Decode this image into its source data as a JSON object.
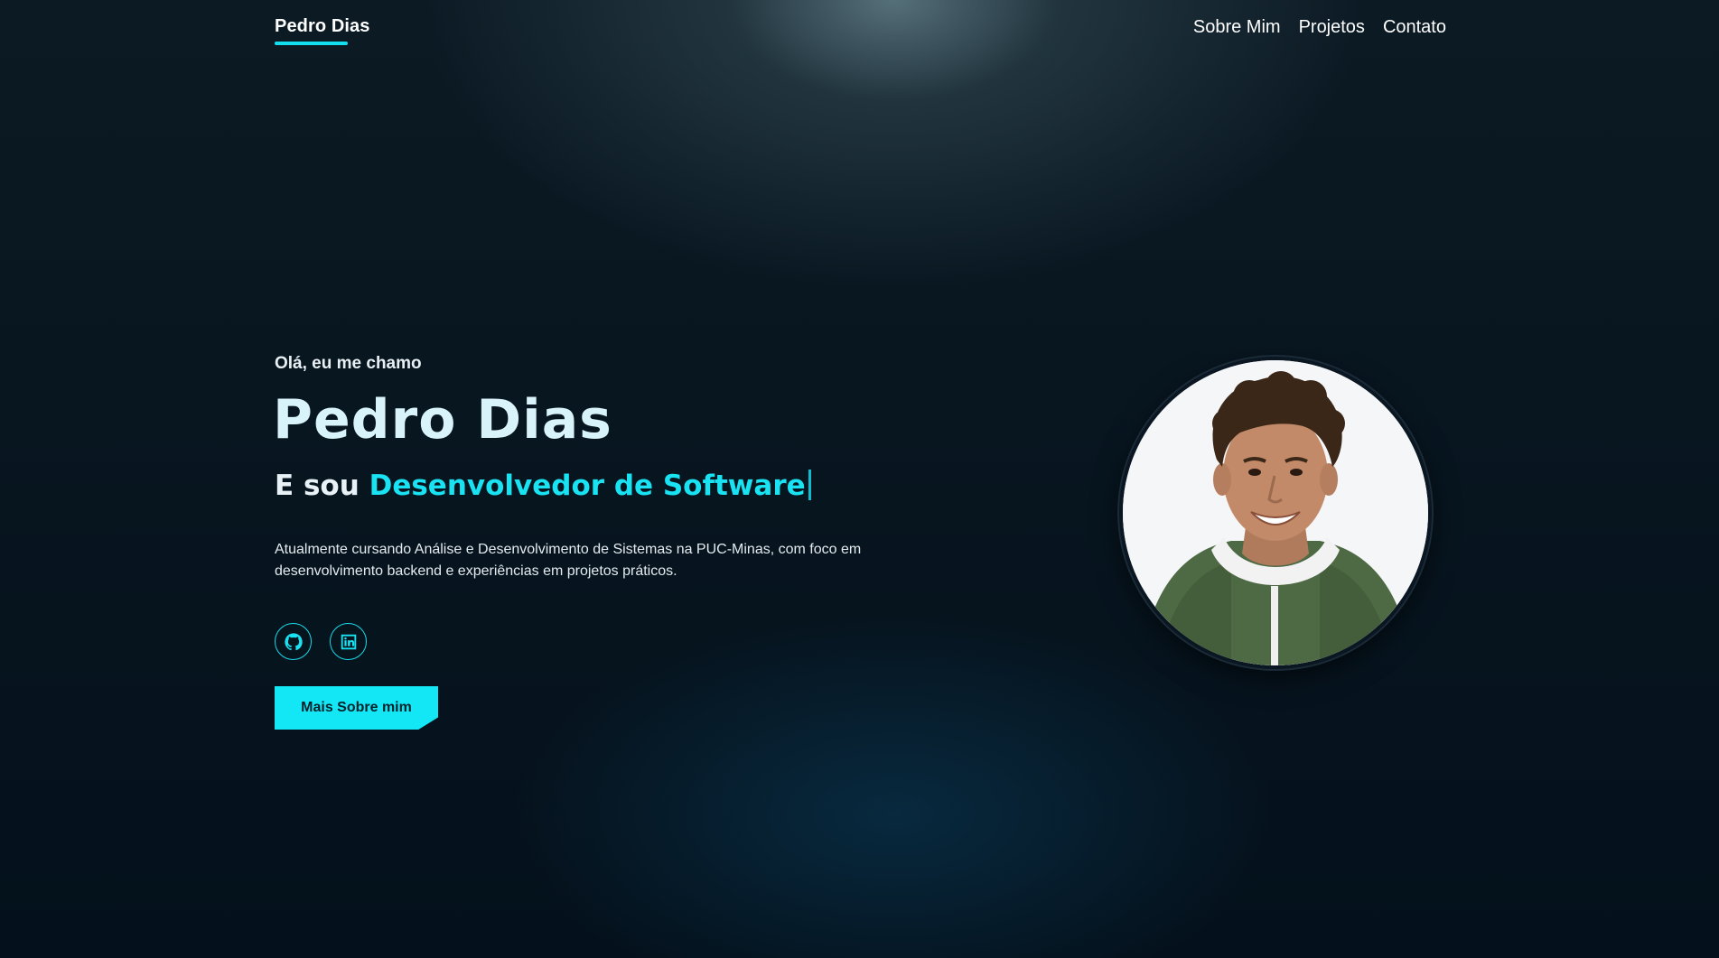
{
  "nav": {
    "brand": "Pedro Dias",
    "links": [
      "Sobre Mim",
      "Projetos",
      "Contato"
    ]
  },
  "hero": {
    "greeting": "Olá, eu me chamo",
    "name": "Pedro Dias",
    "role_prefix": "E sou ",
    "role_highlight": "Desenvolvedor de Software",
    "description": "Atualmente cursando Análise e Desenvolvimento de Sistemas na PUC-Minas, com foco em desenvolvimento backend e experiências em projetos práticos.",
    "socials": [
      {
        "name": "github",
        "icon": "github-icon"
      },
      {
        "name": "linkedin",
        "icon": "linkedin-icon"
      }
    ],
    "cta_label": "Mais Sobre mim"
  },
  "colors": {
    "accent": "#13e6f5",
    "background": "#04111c",
    "text": "#ffffff"
  }
}
